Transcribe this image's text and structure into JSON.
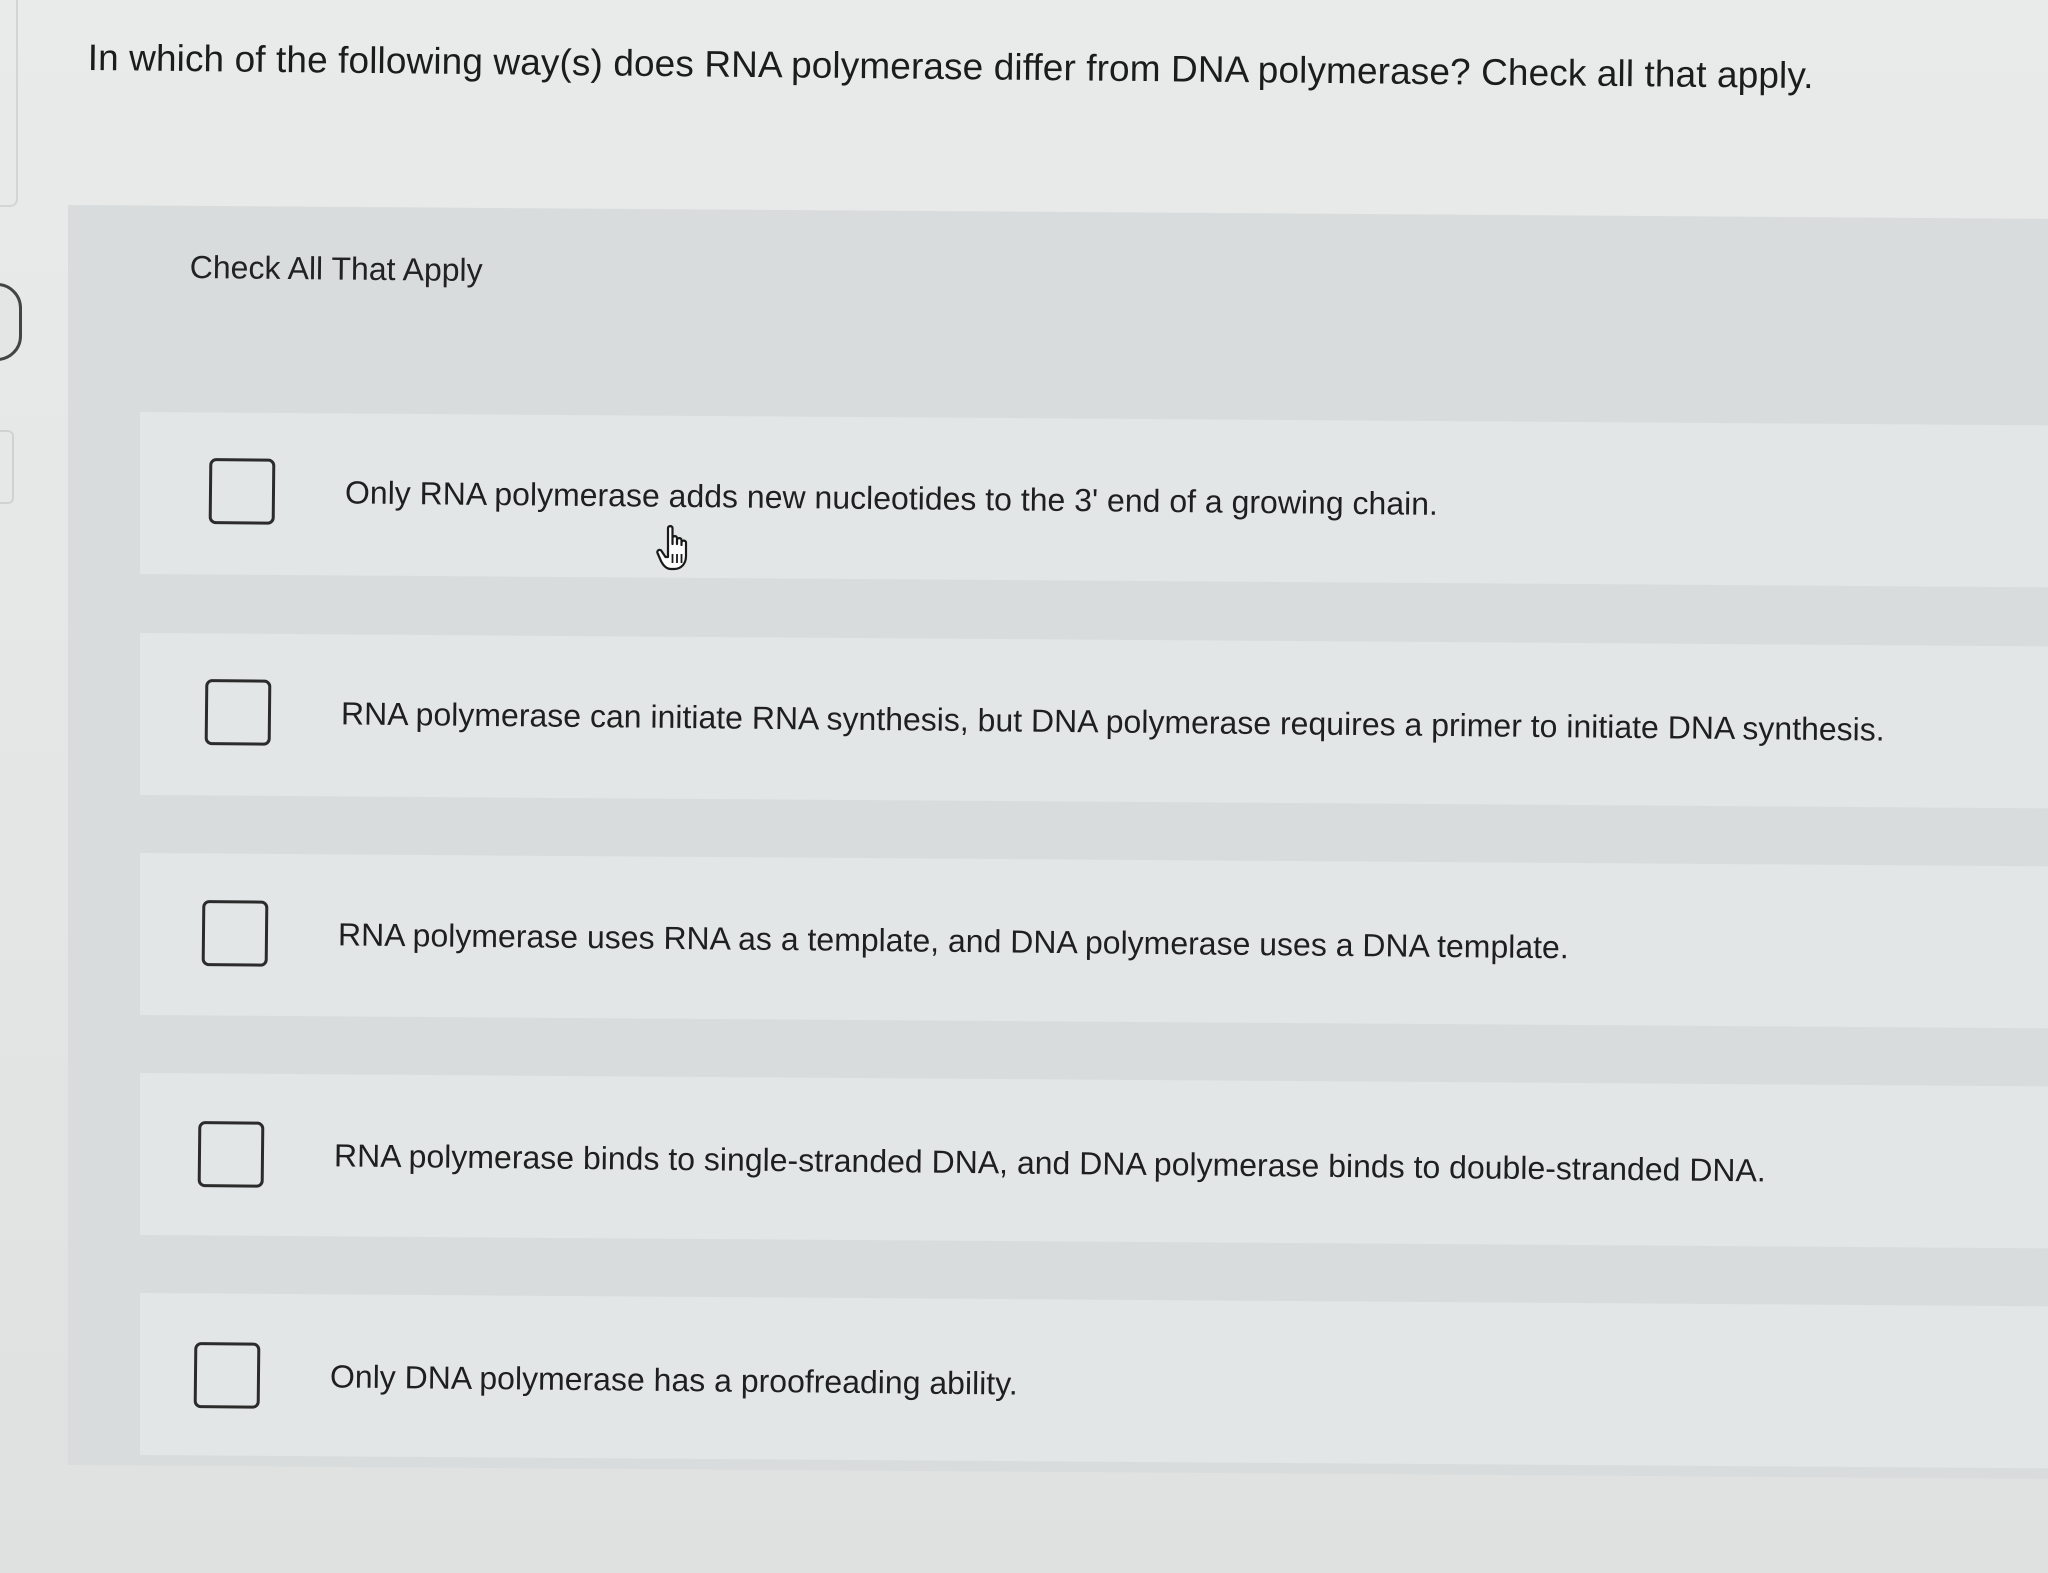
{
  "question": {
    "text": "In which of the following way(s) does RNA polymerase differ from DNA polymerase? Check all that apply."
  },
  "panel": {
    "header": "Check All That Apply"
  },
  "options": [
    {
      "label": "Only RNA polymerase adds new nucleotides to the 3' end of a growing chain.",
      "checked": false
    },
    {
      "label": "RNA polymerase can initiate RNA synthesis, but DNA polymerase requires a primer to initiate DNA synthesis.",
      "checked": false
    },
    {
      "label": "RNA polymerase uses RNA as a template, and DNA polymerase uses a DNA template.",
      "checked": false
    },
    {
      "label": "RNA polymerase binds to single-stranded DNA, and DNA polymerase binds to double-stranded DNA.",
      "checked": false
    },
    {
      "label": "Only DNA polymerase has a proofreading ability.",
      "checked": false
    }
  ],
  "icons": {
    "cursor": "hand-pointer-icon"
  },
  "colors": {
    "background": "#e6e8e8",
    "panel": "#d9dcdc",
    "option_row": "#e3e6e6",
    "text": "#1c1c1c",
    "checkbox_border": "#2b2b2b"
  }
}
